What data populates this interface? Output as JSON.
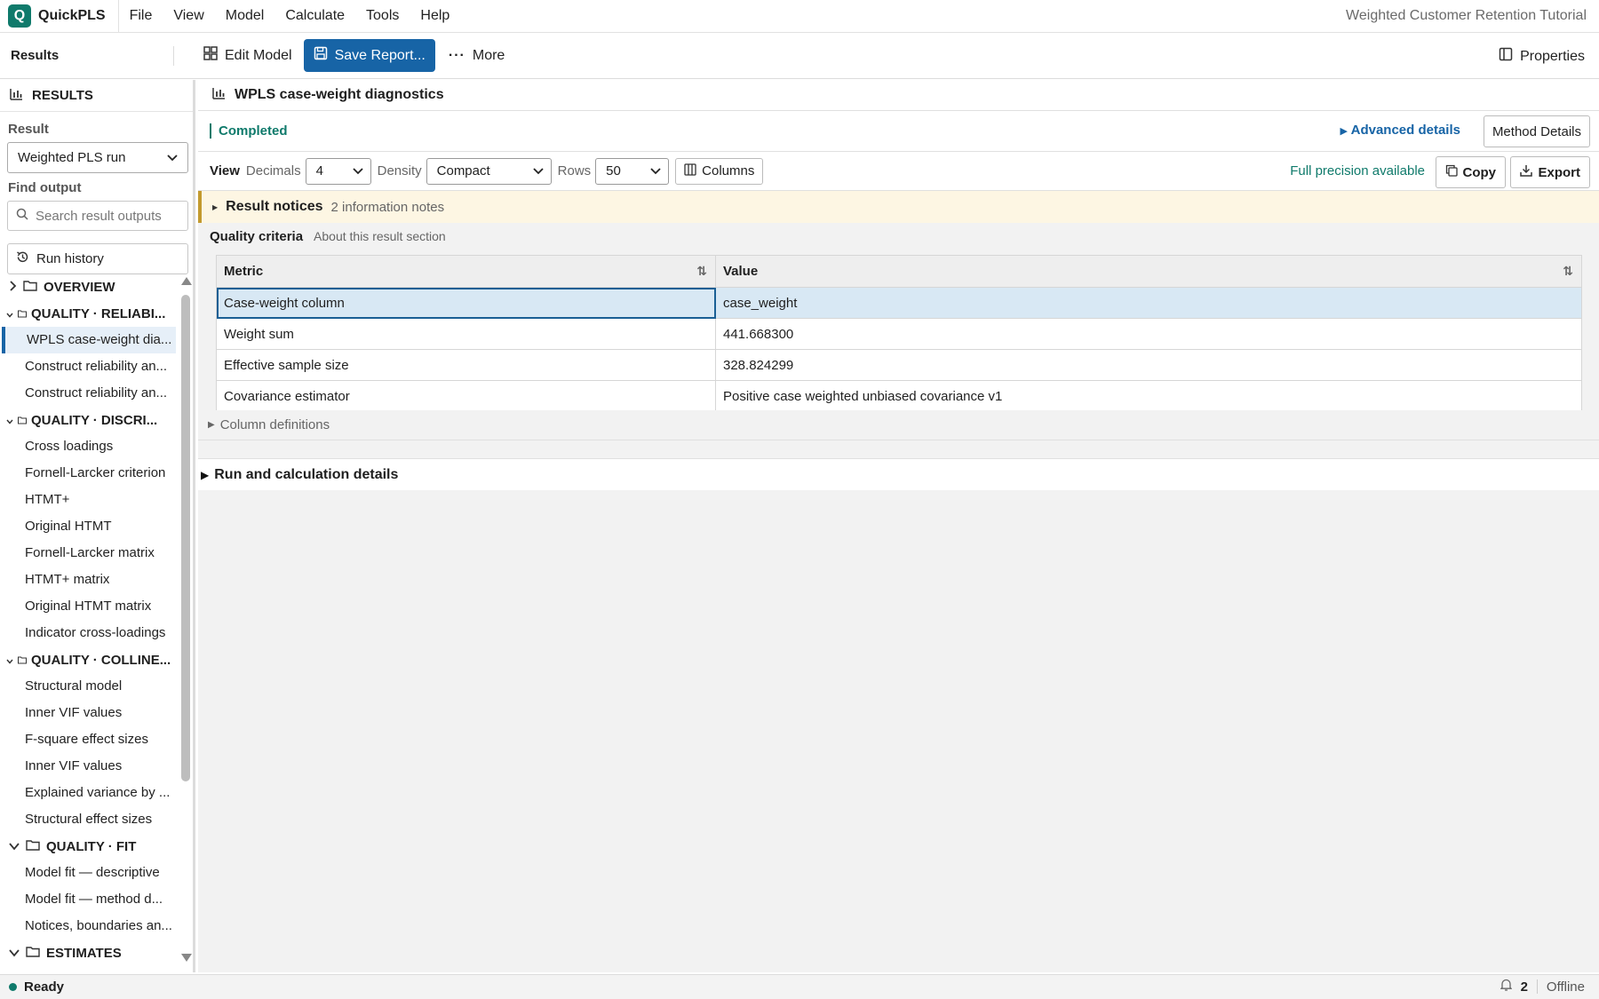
{
  "app": {
    "logo_letter": "Q",
    "name": "QuickPLS",
    "window_title": "Weighted Customer Retention Tutorial"
  },
  "menu": [
    "File",
    "View",
    "Model",
    "Calculate",
    "Tools",
    "Help"
  ],
  "toolbar": {
    "title": "Results",
    "edit_model": "Edit Model",
    "save_report": "Save Report...",
    "more": "More",
    "properties": "Properties"
  },
  "sidebar": {
    "header": "RESULTS",
    "result_label": "Result",
    "result_value": "Weighted PLS run",
    "find_label": "Find output",
    "search_placeholder": "Search result outputs",
    "run_history": "Run history",
    "groups": [
      {
        "label": "OVERVIEW",
        "collapsed": true,
        "items": []
      },
      {
        "label": "QUALITY · RELIABI...",
        "items": [
          "WPLS case-weight dia...",
          "Construct reliability an...",
          "Construct reliability an..."
        ]
      },
      {
        "label": "QUALITY · DISCRI...",
        "items": [
          "Cross loadings",
          "Fornell-Larcker criterion",
          "HTMT+",
          "Original HTMT",
          "Fornell-Larcker matrix",
          "HTMT+ matrix",
          "Original HTMT matrix",
          "Indicator cross-loadings"
        ]
      },
      {
        "label": "QUALITY · COLLINE...",
        "items": [
          "Structural model",
          "Inner VIF values",
          "F-square effect sizes",
          "Inner VIF values",
          "Explained variance by ...",
          "Structural effect sizes"
        ]
      },
      {
        "label": "QUALITY · FIT",
        "items": [
          "Model fit — descriptive",
          "Model fit — method d...",
          "Notices, boundaries an..."
        ]
      },
      {
        "label": "ESTIMATES",
        "items": []
      }
    ]
  },
  "main": {
    "title": "WPLS case-weight diagnostics",
    "status": "Completed",
    "advanced": "Advanced details",
    "method_details": "Method Details",
    "view": {
      "label": "View",
      "decimals_label": "Decimals",
      "decimals": "4",
      "density_label": "Density",
      "density": "Compact",
      "rows_label": "Rows",
      "rows": "50",
      "columns": "Columns"
    },
    "precision": "Full precision available",
    "copy": "Copy",
    "export": "Export",
    "notices": {
      "title": "Result notices",
      "sub": "2 information notes"
    },
    "section": {
      "title": "Quality criteria",
      "sub": "About this result section"
    },
    "table": {
      "headers": [
        "Metric",
        "Value"
      ],
      "rows": [
        [
          "Case-weight column",
          "case_weight"
        ],
        [
          "Weight sum",
          "441.668300"
        ],
        [
          "Effective sample size",
          "328.824299"
        ],
        [
          "Covariance estimator",
          "Positive case weighted unbiased covariance v1"
        ]
      ]
    },
    "column_definitions": "Column definitions",
    "run_details": "Run and calculation details"
  },
  "statusbar": {
    "ready": "Ready",
    "notifications": "2",
    "connection": "Offline"
  },
  "colors": {
    "accent": "#1764a6",
    "brand": "#0f7a6b",
    "notice_bg": "#fdf6e3"
  }
}
